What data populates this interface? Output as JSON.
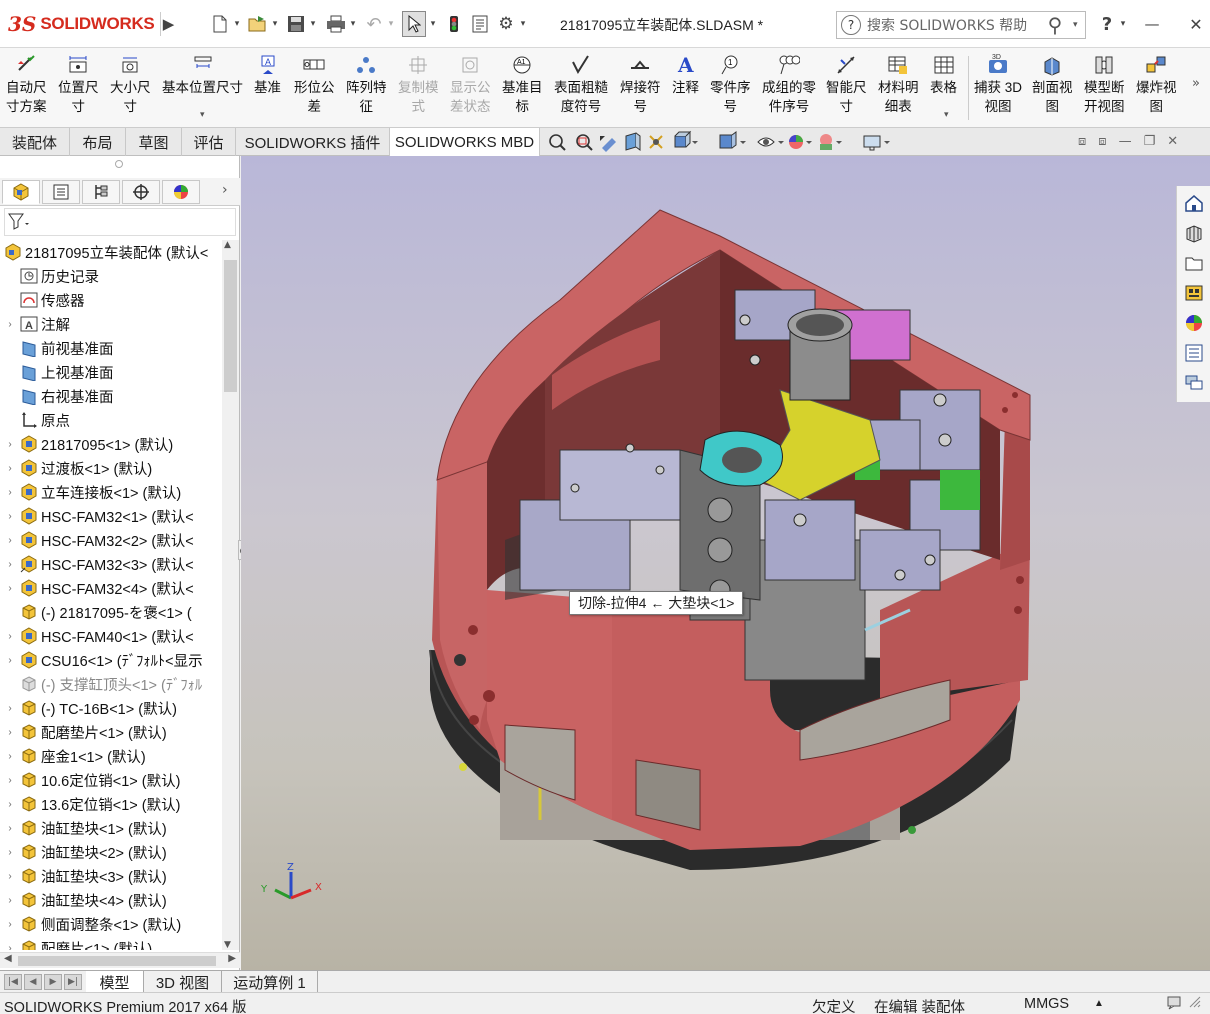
{
  "app": {
    "logo_ds": "3S",
    "logo_name": "SOLIDWORKS",
    "title": "21817095立车装配体.SLDASM *"
  },
  "help": {
    "placeholder": "搜索 SOLIDWORKS 帮助",
    "question": "?",
    "question_mark": "?"
  },
  "window": {
    "minimize": "—",
    "close": "✕"
  },
  "commands": [
    {
      "label1": "自动尺",
      "label2": "寸方案",
      "icon": "auto-dimension-icon",
      "enabled": true
    },
    {
      "label1": "位置尺",
      "label2": "寸",
      "icon": "location-dimension-icon",
      "enabled": true
    },
    {
      "label1": "大小尺",
      "label2": "寸",
      "icon": "size-dimension-icon",
      "enabled": true
    },
    {
      "label1": "基本位置尺寸",
      "label2": "",
      "icon": "basic-location-dimension-icon",
      "enabled": true
    },
    {
      "label1": "基准",
      "label2": "",
      "icon": "datum-icon",
      "enabled": true
    },
    {
      "label1": "形位公",
      "label2": "差",
      "icon": "geometric-tolerance-icon",
      "enabled": true
    },
    {
      "label1": "阵列特",
      "label2": "征",
      "icon": "pattern-feature-icon",
      "enabled": true
    },
    {
      "label1": "复制模",
      "label2": "式",
      "icon": "copy-scheme-icon",
      "enabled": false
    },
    {
      "label1": "显示公",
      "label2": "差状态",
      "icon": "show-tolerance-status-icon",
      "enabled": false
    },
    {
      "label1": "基准目",
      "label2": "标",
      "icon": "datum-target-icon",
      "enabled": true
    },
    {
      "label1": "表面粗糙",
      "label2": "度符号",
      "icon": "surface-finish-icon",
      "enabled": true
    },
    {
      "label1": "焊接符",
      "label2": "号",
      "icon": "weld-symbol-icon",
      "enabled": true
    },
    {
      "label1": "注释",
      "label2": "",
      "icon": "note-icon",
      "enabled": true
    },
    {
      "label1": "零件序",
      "label2": "号",
      "icon": "balloon-icon",
      "enabled": true
    },
    {
      "label1": "成组的零",
      "label2": "件序号",
      "icon": "stacked-balloon-icon",
      "enabled": true
    },
    {
      "label1": "智能尺",
      "label2": "寸",
      "icon": "smart-dimension-icon",
      "enabled": true
    },
    {
      "label1": "材料明",
      "label2": "细表",
      "icon": "bom-icon",
      "enabled": true
    },
    {
      "label1": "表格",
      "label2": "",
      "icon": "table-icon",
      "enabled": true
    },
    {
      "label1": "捕获 3D",
      "label2": "视图",
      "icon": "capture-3d-view-icon",
      "enabled": true
    },
    {
      "label1": "剖面视",
      "label2": "图",
      "icon": "section-view-icon",
      "enabled": true
    },
    {
      "label1": "模型断",
      "label2": "开视图",
      "icon": "model-break-view-icon",
      "enabled": true
    },
    {
      "label1": "爆炸视",
      "label2": "图",
      "icon": "exploded-view-icon",
      "enabled": true
    }
  ],
  "tabs": [
    "装配体",
    "布局",
    "草图",
    "评估",
    "SOLIDWORKS 插件",
    "SOLIDWORKS MBD"
  ],
  "active_tab": "SOLIDWORKS MBD",
  "tree": [
    {
      "text": "21817095立车装配体 (默认<",
      "icon": "assembly",
      "expand": "",
      "level": 0
    },
    {
      "text": "历史记录",
      "icon": "history",
      "expand": "",
      "level": 1
    },
    {
      "text": "传感器",
      "icon": "sensor",
      "expand": "",
      "level": 1
    },
    {
      "text": "注解",
      "icon": "annotation",
      "expand": "›",
      "level": 1
    },
    {
      "text": "前视基准面",
      "icon": "plane",
      "expand": "",
      "level": 1
    },
    {
      "text": "上视基准面",
      "icon": "plane",
      "expand": "",
      "level": 1
    },
    {
      "text": "右视基准面",
      "icon": "plane",
      "expand": "",
      "level": 1
    },
    {
      "text": "原点",
      "icon": "origin",
      "expand": "",
      "level": 1
    },
    {
      "text": "21817095<1> (默认)",
      "icon": "subassembly",
      "expand": "›",
      "level": 1
    },
    {
      "text": "过渡板<1> (默认)",
      "icon": "subassembly",
      "expand": "›",
      "level": 1
    },
    {
      "text": "立车连接板<1> (默认)",
      "icon": "subassembly",
      "expand": "›",
      "level": 1
    },
    {
      "text": "HSC-FAM32<1> (默认<",
      "icon": "subassembly",
      "expand": "›",
      "level": 1
    },
    {
      "text": "HSC-FAM32<2> (默认<",
      "icon": "subassembly",
      "expand": "›",
      "level": 1
    },
    {
      "text": "HSC-FAM32<3> (默认<",
      "icon": "subassembly-edit",
      "expand": "›",
      "level": 1
    },
    {
      "text": "HSC-FAM32<4> (默认<",
      "icon": "subassembly",
      "expand": "›",
      "level": 1
    },
    {
      "text": "(-) 21817095-を褒<1> (",
      "icon": "part-float",
      "expand": "",
      "level": 1
    },
    {
      "text": "HSC-FAM40<1> (默认<",
      "icon": "subassembly",
      "expand": "›",
      "level": 1
    },
    {
      "text": "CSU16<1> (ﾃﾞﾌｫﾙﾄ<显示",
      "icon": "subassembly",
      "expand": "›",
      "level": 1
    },
    {
      "text": "(-) 支撑缸顶头<1> (ﾃﾞﾌｫﾙ",
      "icon": "suppressed",
      "expand": "",
      "level": 1,
      "dim": true
    },
    {
      "text": "(-) TC-16B<1> (默认)",
      "icon": "part-float",
      "expand": "›",
      "level": 1
    },
    {
      "text": "配磨垫片<1> (默认)",
      "icon": "part",
      "expand": "›",
      "level": 1
    },
    {
      "text": "座金1<1> (默认)",
      "icon": "part",
      "expand": "›",
      "level": 1
    },
    {
      "text": "10.6定位销<1> (默认)",
      "icon": "part",
      "expand": "›",
      "level": 1
    },
    {
      "text": "13.6定位销<1> (默认)",
      "icon": "part",
      "expand": "›",
      "level": 1
    },
    {
      "text": "油缸垫块<1> (默认)",
      "icon": "part",
      "expand": "›",
      "level": 1
    },
    {
      "text": "油缸垫块<2> (默认)",
      "icon": "part",
      "expand": "›",
      "level": 1
    },
    {
      "text": "油缸垫块<3> (默认)",
      "icon": "part",
      "expand": "›",
      "level": 1
    },
    {
      "text": "油缸垫块<4> (默认)",
      "icon": "part",
      "expand": "›",
      "level": 1
    },
    {
      "text": "侧面调整条<1> (默认)",
      "icon": "part",
      "expand": "›",
      "level": 1
    },
    {
      "text": "配磨片<1> (默认)",
      "icon": "part",
      "expand": "›",
      "level": 1
    }
  ],
  "tooltip": "切除-拉伸4 ← 大垫块<1>",
  "bottom_tabs": [
    "模型",
    "3D 视图",
    "运动算例 1"
  ],
  "status": {
    "product": "SOLIDWORKS Premium 2017 x64 版",
    "state": "欠定义",
    "mode": "在编辑 装配体",
    "units": "MMGS"
  },
  "triad": {
    "x": "X",
    "y": "Y",
    "z": "Z"
  },
  "colors": {
    "frame": "#c45e5e",
    "frame_dark": "#7a3535",
    "base": "#2a2a2a",
    "accent": "#d52b1e"
  }
}
